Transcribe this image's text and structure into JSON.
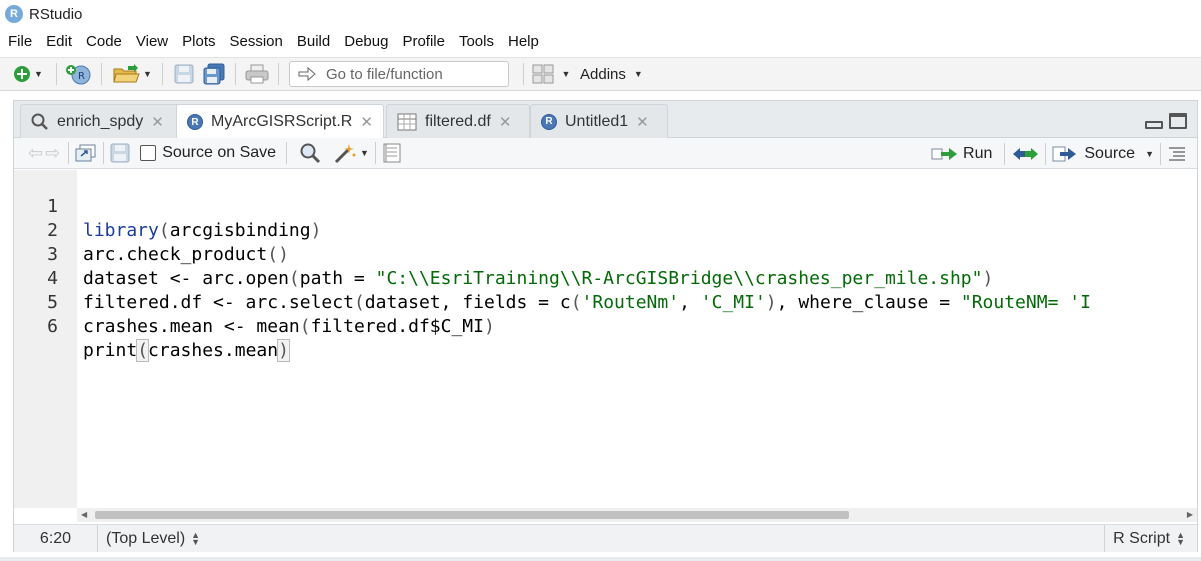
{
  "window": {
    "title": "RStudio",
    "logo_letter": "R"
  },
  "menu": [
    "File",
    "Edit",
    "Code",
    "View",
    "Plots",
    "Session",
    "Build",
    "Debug",
    "Profile",
    "Tools",
    "Help"
  ],
  "toolbar": {
    "goto_placeholder": "Go to file/function",
    "addins_label": "Addins"
  },
  "tabs": [
    {
      "label": "enrich_spdy",
      "icon": "search-icon",
      "active": false
    },
    {
      "label": "MyArcGISRScript.R",
      "icon": "r-file-icon",
      "active": true
    },
    {
      "label": "filtered.df",
      "icon": "table-icon",
      "active": false
    },
    {
      "label": "Untitled1",
      "icon": "r-file-icon",
      "active": false
    }
  ],
  "editor_toolbar": {
    "source_on_save_label": "Source on Save",
    "source_on_save_checked": false,
    "run_label": "Run",
    "source_label": "Source"
  },
  "code_lines": [
    {
      "num": "1",
      "text": "library(arcgisbinding)"
    },
    {
      "num": "2",
      "text": "arc.check_product()"
    },
    {
      "num": "3",
      "text": "dataset <- arc.open(path = \"C:\\\\EsriTraining\\\\R-ArcGISBridge\\\\crashes_per_mile.shp\")"
    },
    {
      "num": "4",
      "text": "filtered.df <- arc.select(dataset, fields = c('RouteNm', 'C_MI'), where_clause = \"RouteNM= 'I"
    },
    {
      "num": "5",
      "text": "crashes.mean <- mean(filtered.df$C_MI)"
    },
    {
      "num": "6",
      "text": "print(crashes.mean)"
    }
  ],
  "status": {
    "cursor_position": "6:20",
    "scope": "(Top Level)",
    "file_type": "R Script"
  },
  "colors": {
    "function": "#1a3c9c",
    "string": "#036a07",
    "logo": "#75aadb"
  }
}
